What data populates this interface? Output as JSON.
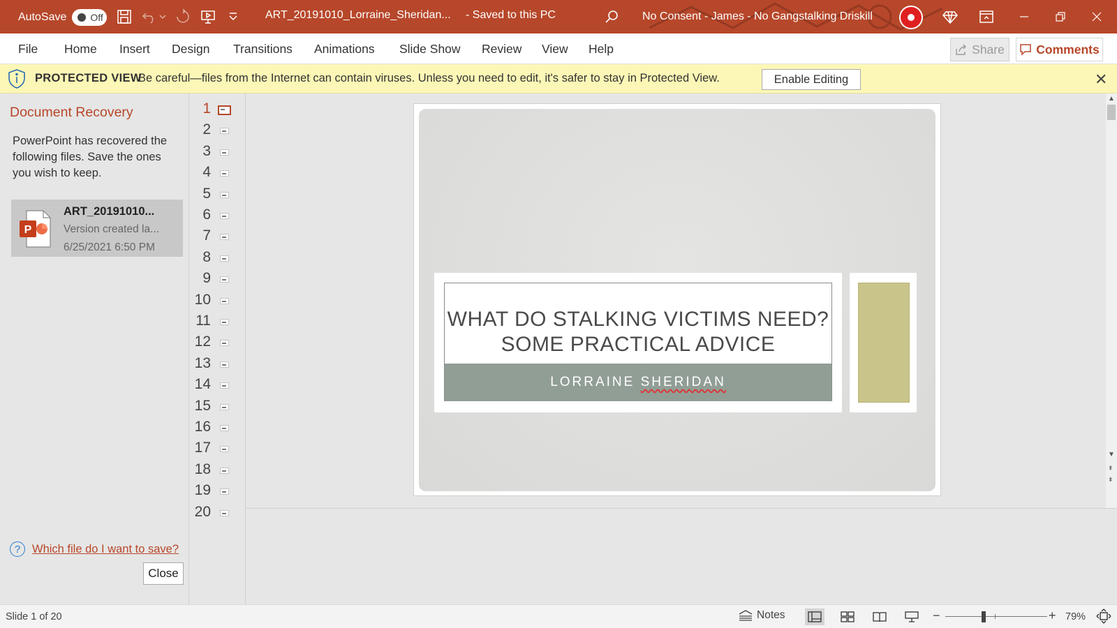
{
  "titlebar": {
    "autosave_label": "AutoSave",
    "autosave_state": "Off",
    "document_title": "ART_20191010_Lorraine_Sheridan...",
    "save_status": "- Saved to this PC",
    "account_name": "No Consent - James - No Gangstalking Driskill",
    "accent_color": "#b7472a"
  },
  "ribbon": {
    "tabs": [
      "File",
      "Home",
      "Insert",
      "Design",
      "Transitions",
      "Animations",
      "Slide Show",
      "Review",
      "View",
      "Help"
    ],
    "share_label": "Share",
    "comments_label": "Comments"
  },
  "protected_view": {
    "label": "PROTECTED VIEW",
    "message": "Be careful—files from the Internet can contain viruses. Unless you need to edit, it's safer to stay in Protected View.",
    "enable_button": "Enable Editing",
    "close_icon": "close-icon"
  },
  "recovery": {
    "title": "Document Recovery",
    "description": "PowerPoint has recovered the following files.  Save the ones you wish to keep.",
    "file": {
      "name": "ART_20191010...",
      "version": "Version created la...",
      "date": "6/25/2021 6:50 PM"
    },
    "help_link": "Which file do I want to save?",
    "close_button": "Close"
  },
  "thumbnails": {
    "active": 1,
    "numbers": [
      "1",
      "2",
      "3",
      "4",
      "5",
      "6",
      "7",
      "8",
      "9",
      "10",
      "11",
      "12",
      "13",
      "14",
      "15",
      "16",
      "17",
      "18",
      "19",
      "20"
    ]
  },
  "slide": {
    "title_line1": "WHAT DO STALKING VICTIMS NEED?",
    "title_line2": "SOME PRACTICAL ADVICE",
    "subtitle_first": "LORRAINE ",
    "subtitle_last": "SHERIDAN",
    "subtitle_band_color": "#919e96",
    "accent_block_color": "#c9c58a"
  },
  "statusbar": {
    "slide_info": "Slide 1 of 20",
    "notes_label": "Notes",
    "zoom_level": "79%",
    "zoom_fraction": 0.79
  }
}
